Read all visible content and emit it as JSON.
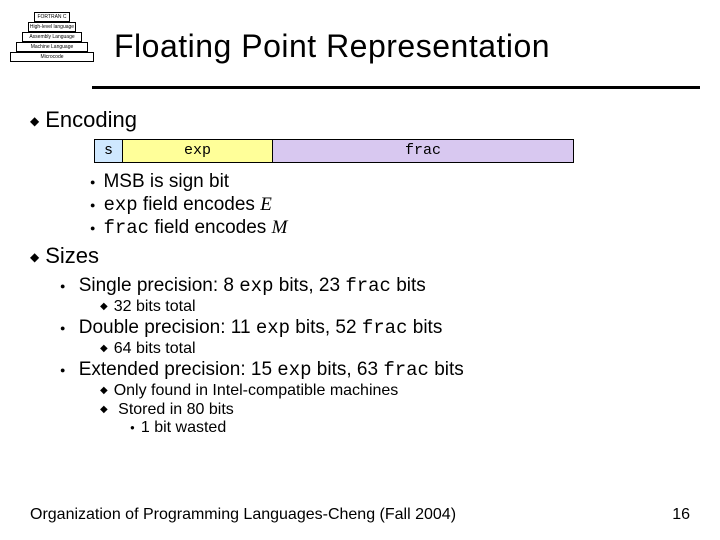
{
  "pyramid": {
    "l0": "FORTRAN   C   PASCAL",
    "l1": "High-level language",
    "l2": "Assembly Language",
    "l3": "Machine Language",
    "l4": "Microcode"
  },
  "title": "Floating Point Representation",
  "encoding": {
    "heading": "Encoding",
    "fields": {
      "s": "s",
      "exp": "exp",
      "frac": "frac"
    },
    "bullets": {
      "b1_pre": "MSB is sign bit",
      "b2_code": "exp",
      "b2_mid": " field encodes ",
      "b2_var": "E",
      "b3_code": "frac",
      "b3_mid": " field encodes ",
      "b3_var": "M"
    }
  },
  "sizes": {
    "heading": "Sizes",
    "single": {
      "pre": "Single precision: 8 ",
      "c1": "exp",
      "mid": " bits, 23 ",
      "c2": "frac",
      "post": " bits",
      "sub": "32 bits total"
    },
    "double": {
      "pre": "Double precision: 11 ",
      "c1": "exp",
      "mid": " bits, 52 ",
      "c2": "frac",
      "post": " bits",
      "sub": "64 bits total"
    },
    "extended": {
      "pre": "Extended precision: 15 ",
      "c1": "exp",
      "mid": " bits, 63 ",
      "c2": "frac",
      "post": " bits",
      "s1": "Only found in Intel-compatible machines",
      "s2": "Stored in 80 bits",
      "s3": "1 bit wasted"
    }
  },
  "footer": {
    "left": "Organization of Programming Languages-Cheng (Fall 2004)",
    "page": "16"
  }
}
